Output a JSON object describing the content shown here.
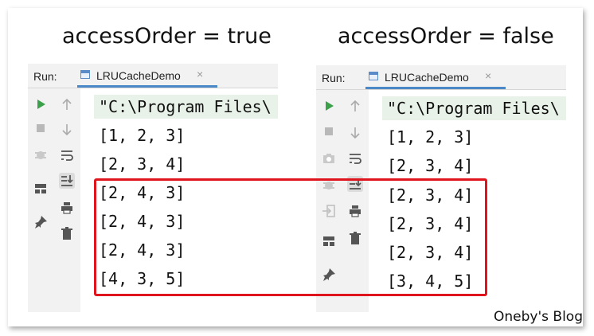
{
  "headings": {
    "left": "accessOrder = true",
    "right": "accessOrder = false"
  },
  "run_label": "Run:",
  "tab_label": "LRUCacheDemo",
  "tab_close": "×",
  "command_line": "\"C:\\Program Files\\",
  "left_console": [
    "[1, 2, 3]",
    "[2, 3, 4]",
    "[2, 4, 3]",
    "[2, 4, 3]",
    "[2, 4, 3]",
    "[4, 3, 5]"
  ],
  "right_console": [
    "[1, 2, 3]",
    "[2, 3, 4]",
    "[2, 3, 4]",
    "[2, 3, 4]",
    "[2, 3, 4]",
    "[3, 4, 5]"
  ],
  "watermark": "Oneby's Blog",
  "colors": {
    "highlight": "#e0141c",
    "run_green": "#3aa04a",
    "command_bg": "#e8f2e8",
    "tab_underline": "#4a88c7"
  },
  "icons": {
    "left_gutter1": [
      "run-icon",
      "stop-icon",
      "debug-icon",
      "layout-icon",
      "pin-icon"
    ],
    "left_gutter2": [
      "arrow-up-icon",
      "arrow-down-icon",
      "soft-wrap-icon",
      "scroll-to-end-icon",
      "print-icon",
      "trash-icon"
    ],
    "right_gutter1": [
      "run-icon",
      "stop-icon",
      "camera-icon",
      "debug-icon",
      "login-icon",
      "layout-icon",
      "pin-icon"
    ],
    "right_gutter2": [
      "arrow-up-icon",
      "arrow-down-icon",
      "soft-wrap-icon",
      "scroll-to-end-icon",
      "print-icon",
      "trash-icon"
    ]
  }
}
